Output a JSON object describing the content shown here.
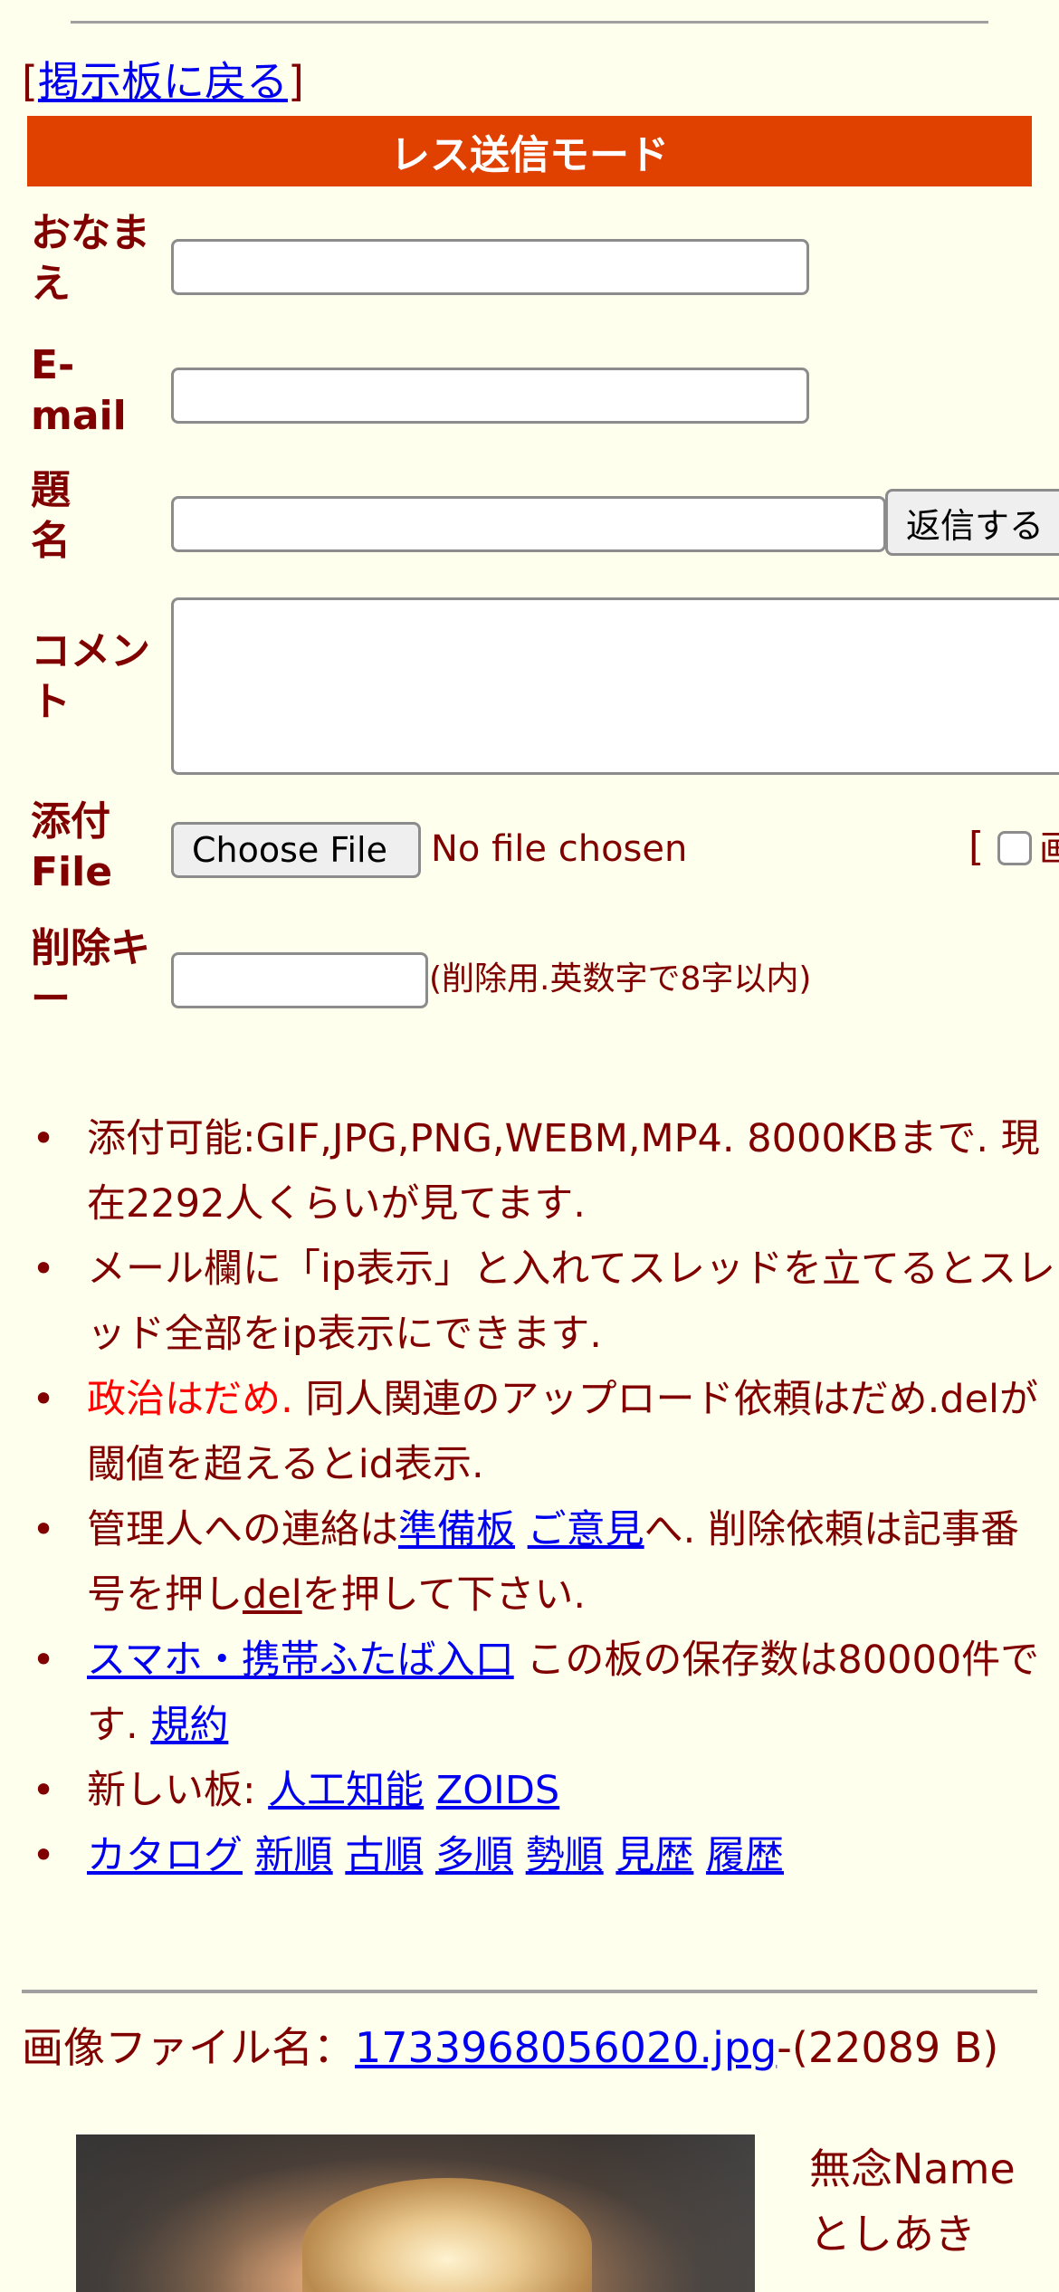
{
  "nav": {
    "back_open": "[",
    "back_link": "掲示板に戻る",
    "back_close": "]"
  },
  "mode_title": "レス送信モード",
  "form": {
    "name_label": "おなまえ",
    "email_label": "E-mail",
    "subject_label": "題名",
    "submit_label": "返信する",
    "comment_label": "コメント",
    "file_label": "添付File",
    "file_button": "Choose File",
    "file_status": "No file chosen",
    "image_toggle_bracket": "[",
    "image_toggle_label": "画",
    "delkey_label": "削除キー",
    "delkey_hint": "(削除用.英数字で8字以内)"
  },
  "rules": {
    "r1": "添付可能:GIF,JPG,PNG,WEBM,MP4. 8000KBまで. 現在2292人くらいが見てます.",
    "r2": "メール欄に「ip表示」と入れてスレッドを立てるとスレッド全部をip表示にできます.",
    "r3_red": "政治はだめ.",
    "r3_rest": " 同人関連のアップロード依頼はだめ.delが閾値を超えるとid表示.",
    "r4_pre": "管理人への連絡は",
    "r4_link1": "準備板",
    "r4_link2": "ご意見",
    "r4_mid": "へ. 削除依頼は記事番号を押し",
    "r4_link3": "del",
    "r4_post": "を押して下さい.",
    "r5_link": "スマホ・携帯ふたば入口",
    "r5_mid": " この板の保存数は80000件です. ",
    "r5_link2": "規約",
    "r6_pre": "新しい板: ",
    "r6_link1": "人工知能",
    "r6_link2": "ZOIDS",
    "sort_links": [
      "カタログ",
      "新順",
      "古順",
      "多順",
      "勢順",
      "見歴",
      "履歴"
    ]
  },
  "post": {
    "file_prefix": "画像ファイル名：",
    "file_name": "1733968056020.jpg",
    "file_size": "-(22089 B)",
    "subject": "無念",
    "name": "Name",
    "poster": "としあき"
  }
}
